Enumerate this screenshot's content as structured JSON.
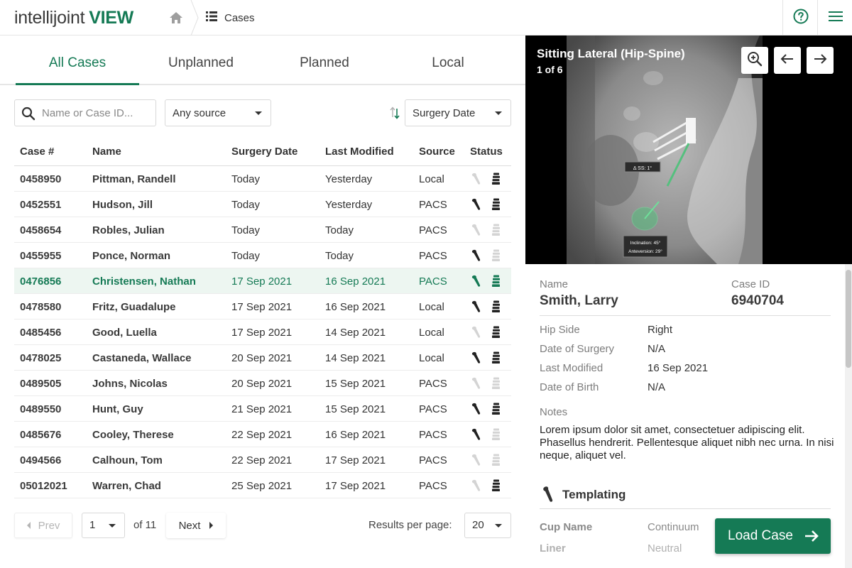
{
  "app": {
    "logo_main": "intellijoint",
    "logo_accent": "VIEW",
    "breadcrumb": "Cases"
  },
  "colors": {
    "brand": "#157a55",
    "selected_row_bg": "#edf6f1",
    "status_active": "#222222",
    "status_inactive": "#d4d4d4"
  },
  "tabs": [
    {
      "label": "All Cases",
      "active": true
    },
    {
      "label": "Unplanned",
      "active": false
    },
    {
      "label": "Planned",
      "active": false
    },
    {
      "label": "Local",
      "active": false
    }
  ],
  "filters": {
    "search_placeholder": "Name or Case ID...",
    "source": "Any source",
    "sort_by": "Surgery Date"
  },
  "table": {
    "columns": [
      "Case #",
      "Name",
      "Surgery Date",
      "Last Modified",
      "Source",
      "Status"
    ],
    "rows": [
      {
        "case": "0458950",
        "name": "Pittman, Randell",
        "surgery": "Today",
        "modified": "Yesterday",
        "source": "Local",
        "hip": false,
        "spine": true,
        "selected": false
      },
      {
        "case": "0452551",
        "name": "Hudson, Jill",
        "surgery": "Today",
        "modified": "Yesterday",
        "source": "PACS",
        "hip": true,
        "spine": true,
        "selected": false
      },
      {
        "case": "0458654",
        "name": "Robles, Julian",
        "surgery": "Today",
        "modified": "Today",
        "source": "PACS",
        "hip": false,
        "spine": false,
        "selected": false
      },
      {
        "case": "0455955",
        "name": "Ponce, Norman",
        "surgery": "Today",
        "modified": "Today",
        "source": "PACS",
        "hip": true,
        "spine": false,
        "selected": false
      },
      {
        "case": "0476856",
        "name": "Christensen, Nathan",
        "surgery": "17 Sep 2021",
        "modified": "16 Sep 2021",
        "source": "PACS",
        "hip": true,
        "spine": true,
        "selected": true
      },
      {
        "case": "0478580",
        "name": "Fritz, Guadalupe",
        "surgery": "17 Sep 2021",
        "modified": "16 Sep 2021",
        "source": "Local",
        "hip": true,
        "spine": true,
        "selected": false
      },
      {
        "case": "0485456",
        "name": "Good, Luella",
        "surgery": "17 Sep 2021",
        "modified": "14 Sep 2021",
        "source": "Local",
        "hip": false,
        "spine": true,
        "selected": false
      },
      {
        "case": "0478025",
        "name": "Castaneda, Wallace",
        "surgery": "20 Sep 2021",
        "modified": "14 Sep 2021",
        "source": "Local",
        "hip": true,
        "spine": true,
        "selected": false
      },
      {
        "case": "0489505",
        "name": "Johns, Nicolas",
        "surgery": "20 Sep 2021",
        "modified": "15 Sep 2021",
        "source": "PACS",
        "hip": false,
        "spine": false,
        "selected": false
      },
      {
        "case": "0489550",
        "name": "Hunt, Guy",
        "surgery": "21 Sep 2021",
        "modified": "15 Sep 2021",
        "source": "PACS",
        "hip": true,
        "spine": true,
        "selected": false
      },
      {
        "case": "0485676",
        "name": "Cooley, Therese",
        "surgery": "22 Sep 2021",
        "modified": "16 Sep 2021",
        "source": "PACS",
        "hip": true,
        "spine": false,
        "selected": false
      },
      {
        "case": "0494566",
        "name": "Calhoun, Tom",
        "surgery": "22 Sep 2021",
        "modified": "17 Sep 2021",
        "source": "PACS",
        "hip": false,
        "spine": false,
        "selected": false
      },
      {
        "case": "05012021",
        "name": "Warren, Chad",
        "surgery": "25 Sep 2021",
        "modified": "17 Sep 2021",
        "source": "PACS",
        "hip": false,
        "spine": true,
        "selected": false
      }
    ]
  },
  "pagination": {
    "prev": "Prev",
    "page": "1",
    "of": "of 11",
    "next": "Next",
    "results_label": "Results per page:",
    "per_page": "20"
  },
  "viewer": {
    "title": "Sitting Lateral (Hip-Spine)",
    "counter": "1 of 6",
    "annotation_ss": "Δ SS: 1°",
    "annotation_incl": "Inclination: 45°",
    "annotation_ante": "Anteversion: 29°"
  },
  "details": {
    "name_label": "Name",
    "name": "Smith, Larry",
    "caseid_label": "Case ID",
    "caseid": "6940704",
    "fields": [
      {
        "label": "Hip Side",
        "value": "Right"
      },
      {
        "label": "Date of Surgery",
        "value": "N/A"
      },
      {
        "label": "Last Modified",
        "value": "16 Sep 2021"
      },
      {
        "label": "Date of Birth",
        "value": "N/A"
      }
    ],
    "notes_label": "Notes",
    "notes": "Lorem ipsum dolor sit amet, consectetuer adipiscing elit. Phasellus hendrerit. Pellentesque aliquet nibh nec urna. In nisi neque, aliquet vel.",
    "templating_title": "Templating",
    "templating": [
      {
        "label": "Cup Name",
        "value": "Continuum"
      },
      {
        "label": "Liner",
        "value": "Neutral"
      }
    ],
    "load_button": "Load Case"
  }
}
